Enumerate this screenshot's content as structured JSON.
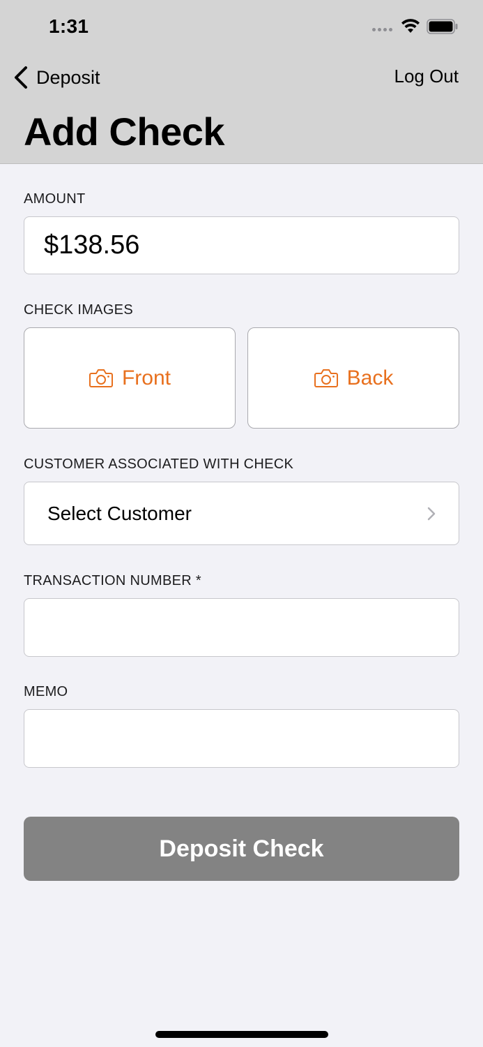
{
  "status_bar": {
    "time": "1:31"
  },
  "nav": {
    "back_label": "Deposit",
    "logout_label": "Log Out",
    "title": "Add Check"
  },
  "form": {
    "amount": {
      "label": "AMOUNT",
      "value": "$138.56"
    },
    "check_images": {
      "label": "CHECK IMAGES",
      "front_label": "Front",
      "back_label": "Back"
    },
    "customer": {
      "label": "CUSTOMER ASSOCIATED WITH CHECK",
      "value": "Select Customer"
    },
    "transaction": {
      "label": "TRANSACTION NUMBER *",
      "value": ""
    },
    "memo": {
      "label": "MEMO",
      "value": ""
    },
    "submit_label": "Deposit Check"
  },
  "icons": {
    "back": "chevron-left-icon",
    "camera": "camera-icon",
    "disclosure": "chevron-right-icon",
    "wifi": "wifi-icon",
    "battery": "battery-icon",
    "signal": "cellular-signal-icon"
  },
  "colors": {
    "accent": "#e8701e",
    "header_bg": "#d4d4d4",
    "page_bg": "#f2f2f7",
    "submit_disabled": "#838383"
  }
}
